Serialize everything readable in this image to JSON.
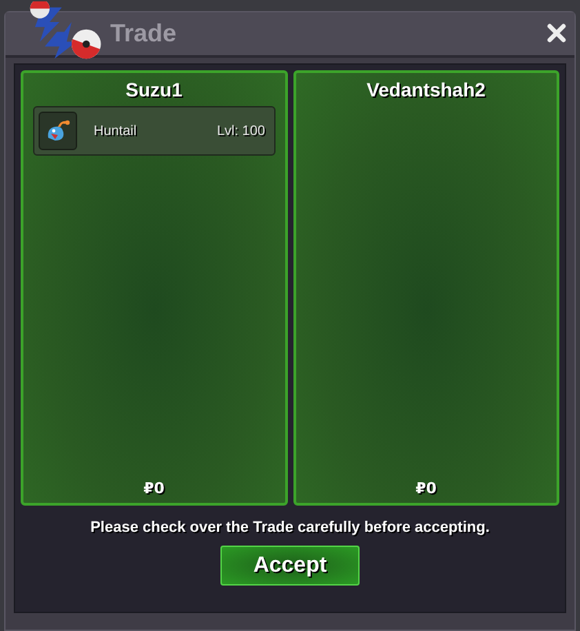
{
  "window": {
    "title": "Trade"
  },
  "traders": [
    {
      "name": "Suzu1",
      "items": [
        {
          "name": "Huntail",
          "level": "Lvl: 100"
        }
      ],
      "money": "₽0"
    },
    {
      "name": "Vedantshah2",
      "money": "₽0"
    }
  ],
  "message": "Please check over the Trade carefully before accepting.",
  "button": "Accept"
}
